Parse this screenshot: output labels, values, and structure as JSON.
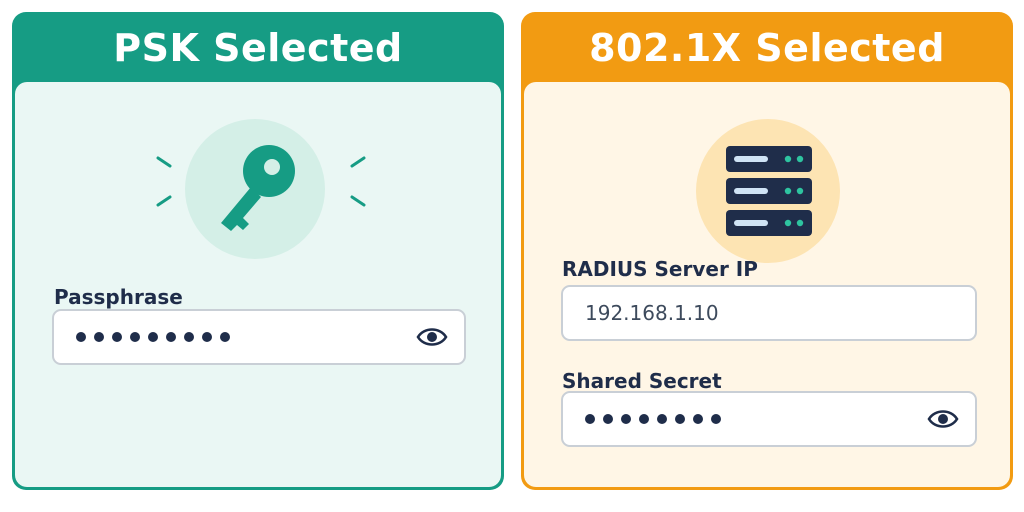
{
  "psk_card": {
    "title": "PSK Selected",
    "icon": "key-icon",
    "passphrase": {
      "label": "Passphrase",
      "masked_length": 9
    }
  },
  "dot1x_card": {
    "title": "802.1X Selected",
    "icon": "server-icon",
    "radius_ip": {
      "label": "RADIUS Server IP",
      "value": "192.168.1.10"
    },
    "shared_secret": {
      "label": "Shared Secret",
      "masked_length": 8
    }
  },
  "colors": {
    "psk_accent": "#169C84",
    "dot1x_accent": "#F29B12",
    "text_dark": "#1F2D4A"
  }
}
